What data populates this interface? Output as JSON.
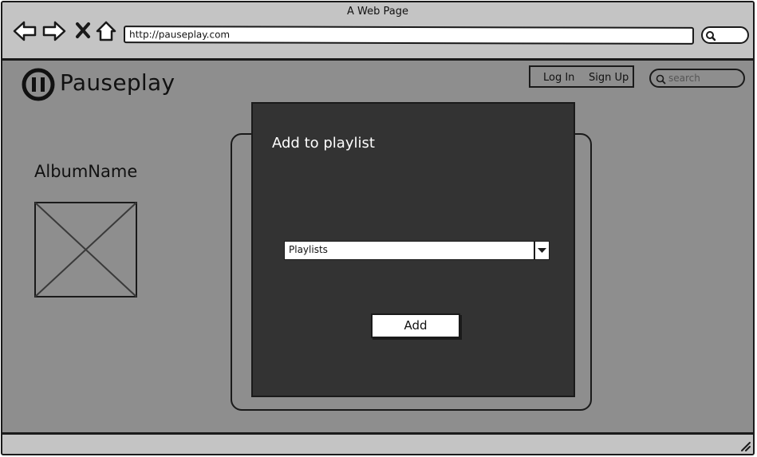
{
  "window": {
    "title": "A Web Page"
  },
  "browser": {
    "url": "http://pauseplay.com",
    "icons": [
      "back-arrow-icon",
      "forward-arrow-icon",
      "close-x-icon",
      "home-icon",
      "search-icon"
    ]
  },
  "header": {
    "logo_icon": "pause-icon",
    "brand": "Pauseplay",
    "login_label": "Log In",
    "signup_label": "Sign Up",
    "search_placeholder": "search"
  },
  "album": {
    "name": "AlbumName",
    "image_icon": "image-placeholder-icon"
  },
  "modal": {
    "title": "Add to playlist",
    "select_value": "Playlists",
    "add_label": "Add"
  },
  "colors": {
    "page_background": "#8e8e8e",
    "chrome": "#c4c4c4",
    "modal_background": "#333333",
    "outline": "#1a1a1a"
  }
}
